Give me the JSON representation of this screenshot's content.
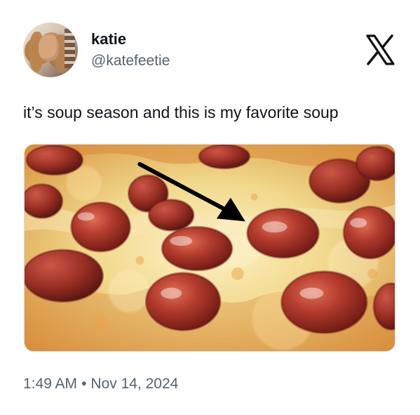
{
  "author": {
    "display_name": "katie",
    "handle": "@katefeetie"
  },
  "post": {
    "text": "it’s soup season and this is my favorite soup",
    "time": "1:49 AM",
    "separator": "•",
    "date": "Nov 14, 2024"
  },
  "media": {
    "alt": "pepperoni pizza with an arrow pointing to a pepperoni filled with grease"
  },
  "icons": {
    "brand_logo": "x-logo"
  },
  "colors": {
    "text_primary": "#0f1419",
    "text_secondary": "#536471",
    "background": "#ffffff"
  }
}
